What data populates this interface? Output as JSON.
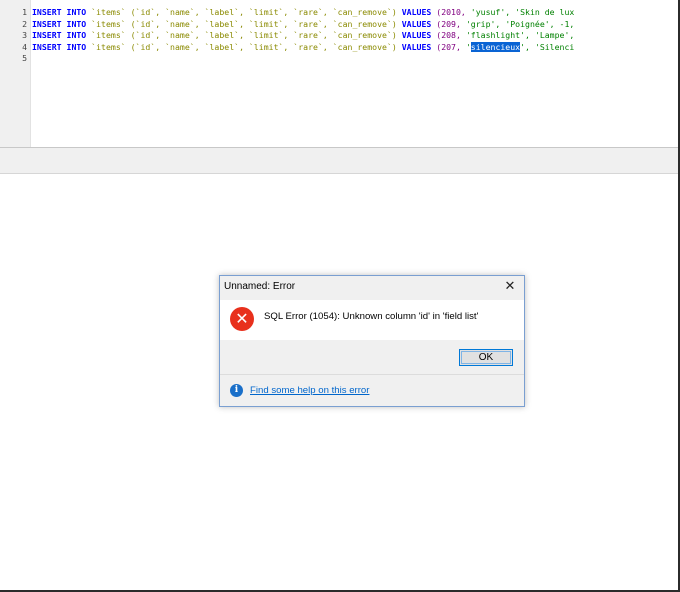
{
  "editor": {
    "line_numbers": [
      "1",
      "2",
      "3",
      "4",
      "5"
    ],
    "lines": [
      {
        "kw_insert": "INSERT",
        "kw_into": "INTO",
        "table": "`items`",
        "columns": "(`id`, `name`, `label`, `limit`, `rare`, `can_remove`)",
        "kw_values": "VALUES",
        "id_value": "(2010,",
        "name_value": "'yusuf',",
        "rest": "'Skin de lux"
      },
      {
        "kw_insert": "INSERT",
        "kw_into": "INTO",
        "table": "`items`",
        "columns": "(`id`, `name`, `label`, `limit`, `rare`, `can_remove`)",
        "kw_values": "VALUES",
        "id_value": "(209,",
        "name_value": "'grip',",
        "rest": "'Poignée', -1,"
      },
      {
        "kw_insert": "INSERT",
        "kw_into": "INTO",
        "table": "`items`",
        "columns": "(`id`, `name`, `label`, `limit`, `rare`, `can_remove`)",
        "kw_values": "VALUES",
        "id_value": "(208,",
        "name_value": "'flashlight',",
        "rest": "'Lampe',"
      },
      {
        "kw_insert": "INSERT",
        "kw_into": "INTO",
        "table": "`items`",
        "columns": "(`id`, `name`, `label`, `limit`, `rare`, `can_remove`)",
        "kw_values": "VALUES",
        "id_value": "(207,",
        "name_pre": "'",
        "name_selected": "silencieux",
        "name_post": "',",
        "rest": "'Silenci"
      }
    ]
  },
  "dialog": {
    "title": "Unnamed: Error",
    "close_glyph": "✕",
    "error_glyph": "✕",
    "message": "SQL Error (1054): Unknown column 'id' in 'field list'",
    "ok_label": "OK",
    "info_glyph": "i",
    "help_link": "Find some help on this error"
  },
  "colors": {
    "keyword": "#0000ff",
    "identifier": "#8a8a00",
    "string": "#008000",
    "number": "#800080",
    "selection": "#0a64d4",
    "error_icon": "#e8301c",
    "link": "#0066cc"
  },
  "icons": {
    "dialog_close": "close-icon",
    "dialog_error": "error-icon",
    "help_info": "info-icon"
  }
}
